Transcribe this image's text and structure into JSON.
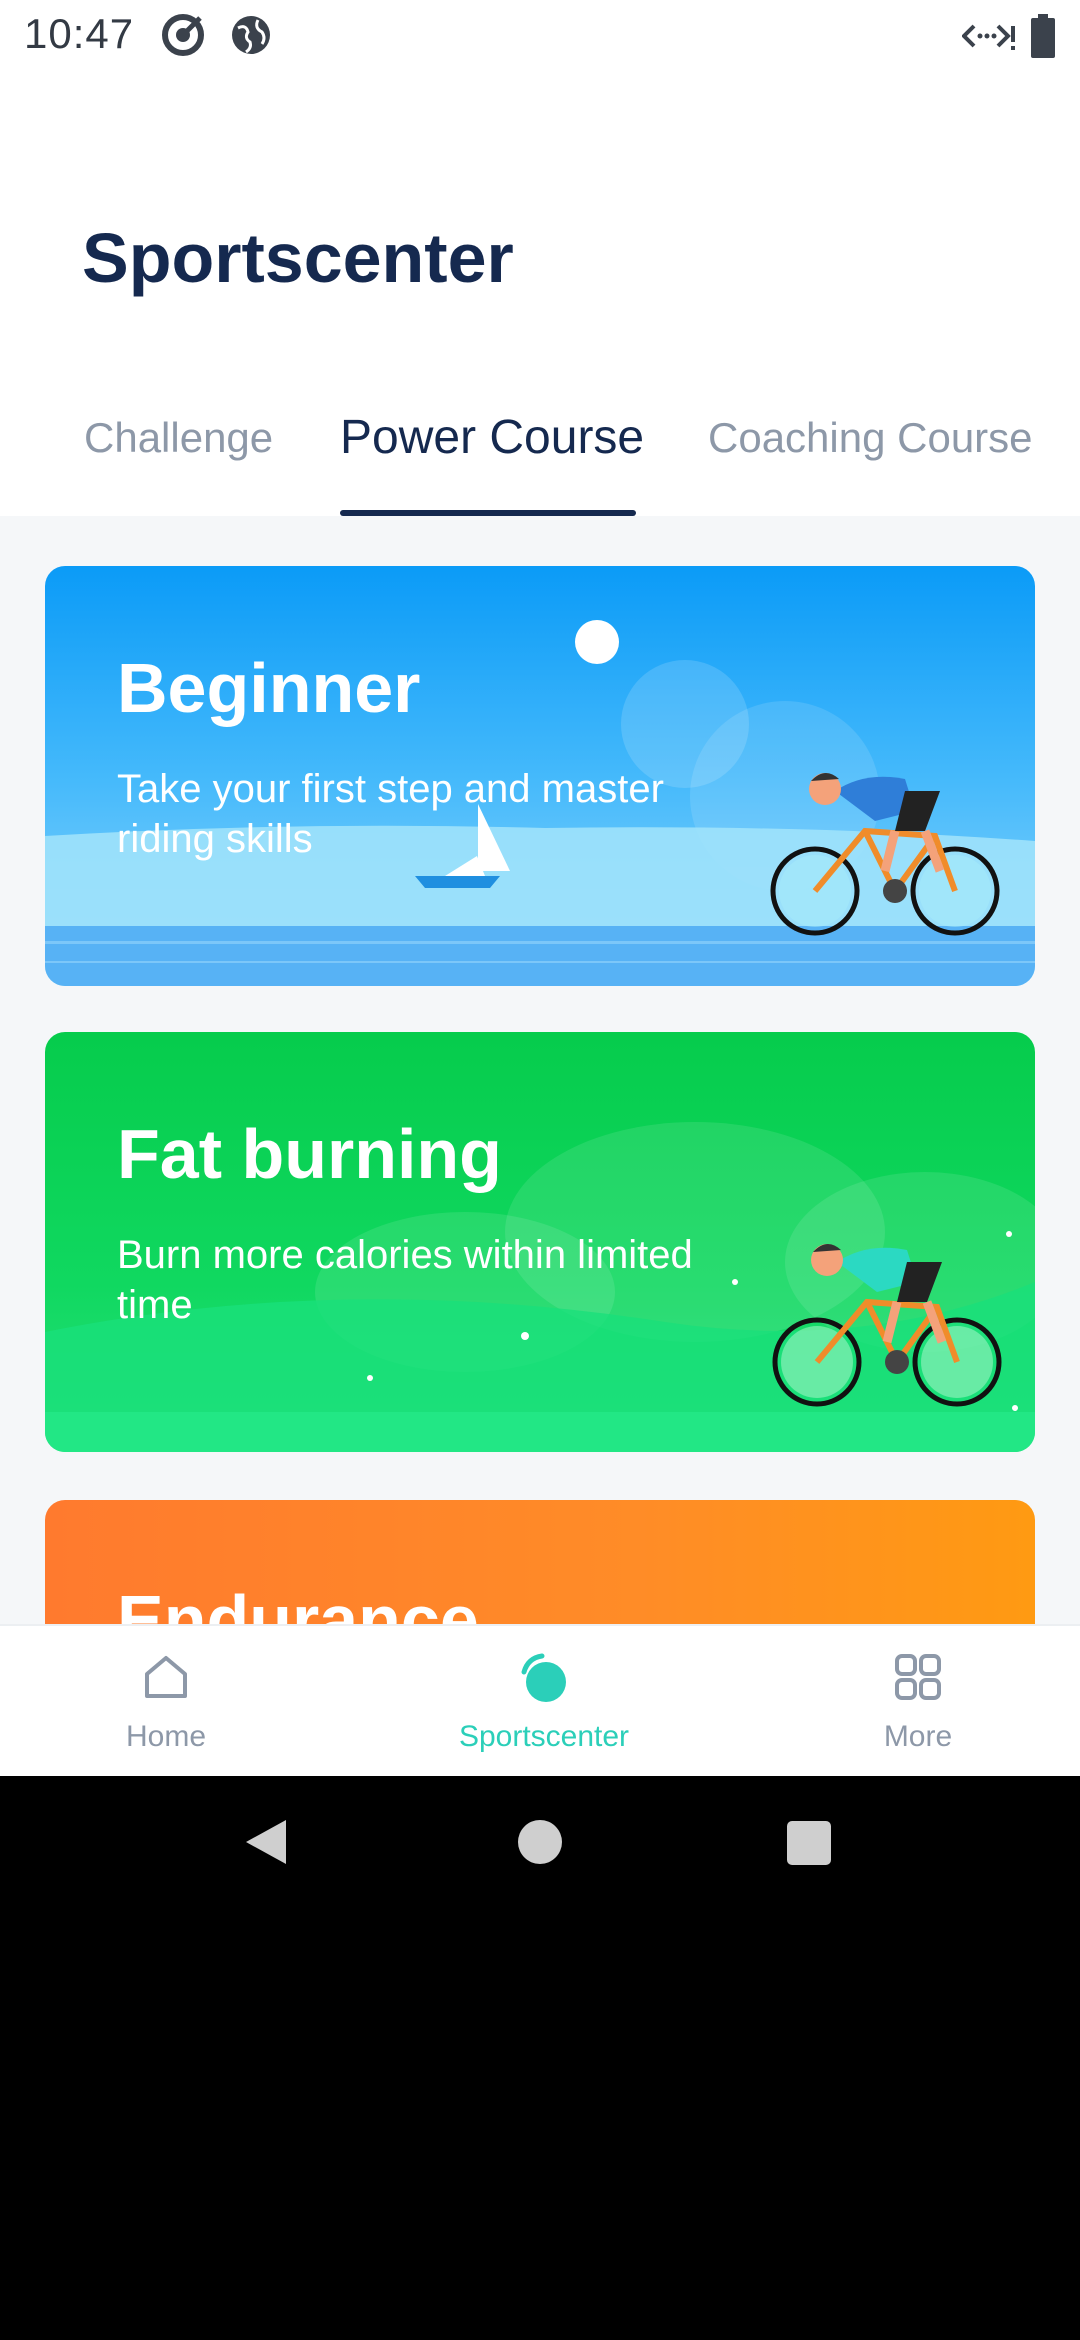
{
  "status_bar": {
    "time": "10:47",
    "icons": [
      "target-icon",
      "globe-icon",
      "data-signal-icon",
      "battery-icon"
    ]
  },
  "header": {
    "title": "Sportscenter"
  },
  "tabs": [
    {
      "label": "Challenge",
      "active": false
    },
    {
      "label": "Power Course",
      "active": true
    },
    {
      "label": "Coaching Course",
      "active": false
    }
  ],
  "cards": [
    {
      "title": "Beginner",
      "description": "Take your first step and master riding skills",
      "color": "#0b9bf7"
    },
    {
      "title": "Fat burning",
      "description": "Burn more calories within limited time",
      "color": "#06cc4c"
    },
    {
      "title": "Endurance",
      "description": "",
      "color": "#ff8c27"
    }
  ],
  "bottom_nav": [
    {
      "label": "Home",
      "icon": "home-icon",
      "active": false
    },
    {
      "label": "Sportscenter",
      "icon": "sportscenter-icon",
      "active": true
    },
    {
      "label": "More",
      "icon": "grid-icon",
      "active": false
    }
  ],
  "colors": {
    "brand_dark": "#15294f",
    "accent": "#2bcfb9",
    "inactive": "#8d98a8"
  }
}
